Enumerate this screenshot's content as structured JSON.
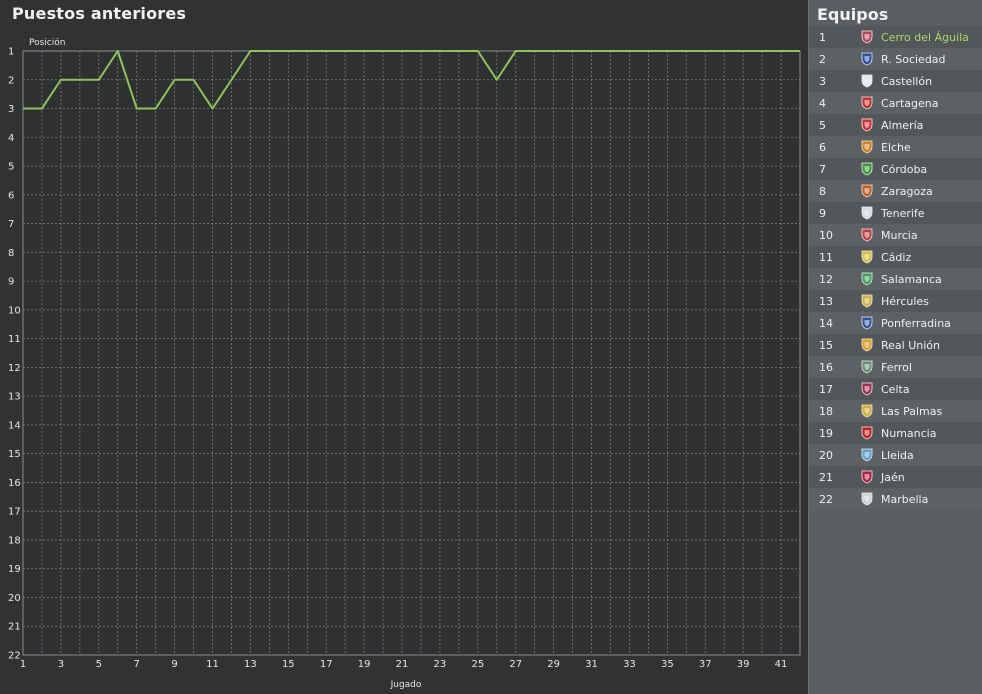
{
  "chart_panel": {
    "title": "Puestos anteriores"
  },
  "chart_data": {
    "type": "line",
    "title": "Puestos anteriores",
    "ylabel": "Posición",
    "xlabel": "Jugado",
    "ylim": [
      1,
      22
    ],
    "y_inverted": true,
    "xlim": [
      1,
      42
    ],
    "x_ticks": [
      1,
      3,
      5,
      7,
      9,
      11,
      13,
      15,
      17,
      19,
      21,
      23,
      25,
      27,
      29,
      31,
      33,
      35,
      37,
      39,
      41
    ],
    "y_ticks": [
      1,
      2,
      3,
      4,
      5,
      6,
      7,
      8,
      9,
      10,
      11,
      12,
      13,
      14,
      15,
      16,
      17,
      18,
      19,
      20,
      21,
      22
    ],
    "grid": true,
    "series": [
      {
        "color": "#8fc35b",
        "x": [
          1,
          2,
          3,
          4,
          5,
          6,
          7,
          8,
          9,
          10,
          11,
          12,
          13,
          14,
          15,
          16,
          17,
          18,
          19,
          20,
          21,
          22,
          23,
          24,
          25,
          26,
          27,
          28,
          29,
          30,
          31,
          32,
          33,
          34,
          35,
          36,
          37,
          38,
          39,
          40,
          41,
          42
        ],
        "values": [
          3,
          3,
          2,
          2,
          2,
          1,
          3,
          3,
          2,
          2,
          3,
          2,
          1,
          1,
          1,
          1,
          1,
          1,
          1,
          1,
          1,
          1,
          1,
          1,
          1,
          2,
          1,
          1,
          1,
          1,
          1,
          1,
          1,
          1,
          1,
          1,
          1,
          1,
          1,
          1,
          1,
          1
        ]
      }
    ]
  },
  "teams_panel": {
    "title": "Equipos",
    "selected_color": "#a9d86e",
    "teams": [
      {
        "pos": "1",
        "name": "Cerro del Águila",
        "crest": "cerro-del-aguila-crest",
        "color": "#b04a5a"
      },
      {
        "pos": "2",
        "name": "R. Sociedad",
        "crest": "r-sociedad-crest",
        "color": "#2a4fa0"
      },
      {
        "pos": "3",
        "name": "Castellón",
        "crest": "castellon-crest",
        "color": "#e8e8e8"
      },
      {
        "pos": "4",
        "name": "Cartagena",
        "crest": "cartagena-crest",
        "color": "#c03030"
      },
      {
        "pos": "5",
        "name": "Almería",
        "crest": "almeria-crest",
        "color": "#d03030"
      },
      {
        "pos": "6",
        "name": "Elche",
        "crest": "elche-crest",
        "color": "#d08020"
      },
      {
        "pos": "7",
        "name": "Córdoba",
        "crest": "cordoba-crest",
        "color": "#3a9a3a"
      },
      {
        "pos": "8",
        "name": "Zaragoza",
        "crest": "zaragoza-crest",
        "color": "#c06020"
      },
      {
        "pos": "9",
        "name": "Tenerife",
        "crest": "tenerife-crest",
        "color": "#d8d8e8"
      },
      {
        "pos": "10",
        "name": "Murcia",
        "crest": "murcia-crest",
        "color": "#c04040"
      },
      {
        "pos": "11",
        "name": "Cádiz",
        "crest": "cadiz-crest",
        "color": "#d8c040"
      },
      {
        "pos": "12",
        "name": "Salamanca",
        "crest": "salamanca-crest",
        "color": "#40a060"
      },
      {
        "pos": "13",
        "name": "Hércules",
        "crest": "hercules-crest",
        "color": "#d0b040"
      },
      {
        "pos": "14",
        "name": "Ponferradina",
        "crest": "ponferradina-crest",
        "color": "#3050a0"
      },
      {
        "pos": "15",
        "name": "Real Unión",
        "crest": "real-union-crest",
        "color": "#e0a020"
      },
      {
        "pos": "16",
        "name": "Ferrol",
        "crest": "ferrol-crest",
        "color": "#609070"
      },
      {
        "pos": "17",
        "name": "Celta",
        "crest": "celta-crest",
        "color": "#a03050"
      },
      {
        "pos": "18",
        "name": "Las Palmas",
        "crest": "las-palmas-crest",
        "color": "#d0b030"
      },
      {
        "pos": "19",
        "name": "Numancia",
        "crest": "numancia-crest",
        "color": "#c02020"
      },
      {
        "pos": "20",
        "name": "Lleida",
        "crest": "lleida-crest",
        "color": "#60a0d0"
      },
      {
        "pos": "21",
        "name": "Jaén",
        "crest": "jaen-crest",
        "color": "#b02040"
      },
      {
        "pos": "22",
        "name": "Marbella",
        "crest": "marbella-crest",
        "color": "#d0d0d0"
      }
    ]
  }
}
